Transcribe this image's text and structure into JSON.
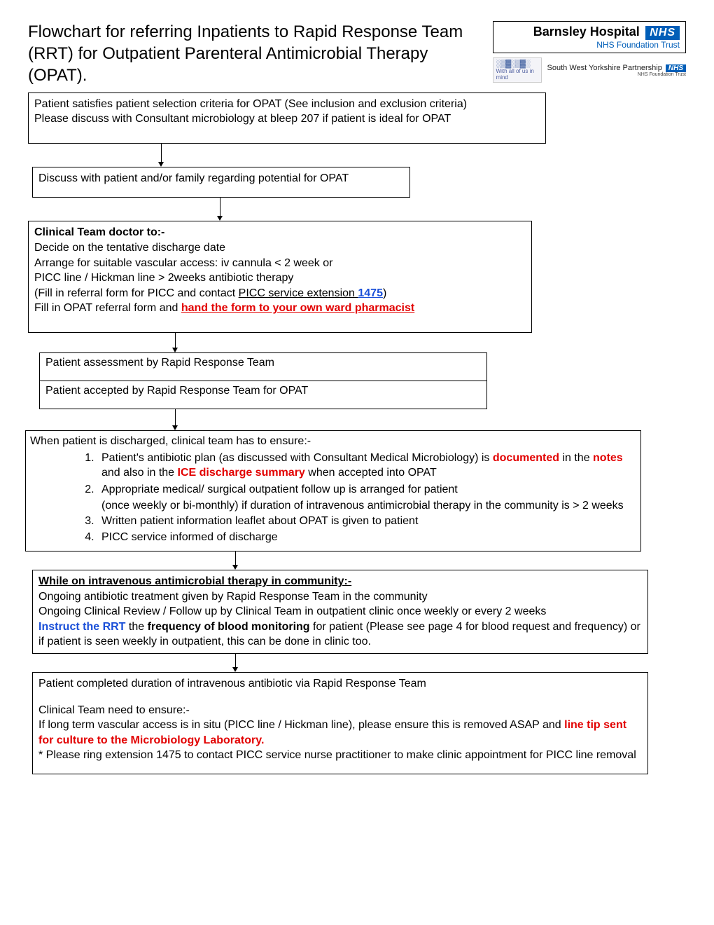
{
  "title": "Flowchart for referring Inpatients to Rapid Response Team (RRT) for Outpatient Parenteral Antimicrobial Therapy (OPAT).",
  "logo1": {
    "hospital": "Barnsley Hospital",
    "nhs": "NHS",
    "trust": "NHS Foundation Trust"
  },
  "logo2": {
    "decor": "░▒▓░▒▓░",
    "tagline": "With all of us in mind",
    "partner": "South West Yorkshire Partnership",
    "nhs": "NHS",
    "sub": "NHS Foundation Trust"
  },
  "b1": {
    "l1": "Patient satisfies patient selection criteria for OPAT (See inclusion and exclusion criteria)",
    "l2": "Please discuss with Consultant microbiology at bleep 207 if patient is ideal for OPAT"
  },
  "b2": "Discuss with patient and/or family regarding potential for OPAT",
  "b3": {
    "h": "Clinical Team doctor to:-",
    "l1": "Decide on the tentative discharge date",
    "l2": "Arrange for suitable vascular access: iv cannula < 2 week or",
    "l3": "PICC line / Hickman line > 2weeks antibiotic therapy",
    "l4a": "(Fill in referral form for PICC and contact ",
    "l4b": "PICC service extension ",
    "l4c": "1475",
    "l4d": ")",
    "l5a": "Fill in OPAT referral form and ",
    "l5b": "hand the form to your own  ward pharmacist"
  },
  "b4a": "Patient assessment by Rapid Response Team",
  "b4b": "Patient accepted by Rapid Response Team for OPAT",
  "b5": {
    "intro": "When patient is discharged, clinical team has to ensure:-",
    "li1a": "Patient's antibiotic plan (as discussed with Consultant Medical Microbiology) is ",
    "li1b": "documented",
    "li1c": " in the ",
    "li1d": "notes",
    "li1e": " and also in the ",
    "li1f": "ICE discharge summary",
    "li1g": " when accepted into OPAT",
    "li2a": "Appropriate medical/ surgical outpatient follow up is arranged for patient",
    "li2b": "(once weekly or bi-monthly) if duration of intravenous antimicrobial therapy in the community is > 2 weeks",
    "li3": "Written patient information leaflet about OPAT is given to patient",
    "li4": "PICC service informed of discharge"
  },
  "b6": {
    "h": "While on intravenous antimicrobial therapy in community:-",
    "l1": "Ongoing antibiotic treatment given by Rapid Response Team in the community",
    "l2": "Ongoing Clinical Review / Follow up by Clinical Team in outpatient clinic once weekly or every 2 weeks",
    "l3a": "Instruct the RRT",
    "l3b": " the ",
    "l3c": "frequency of blood monitoring",
    "l3d": " for patient  (Please see page 4 for blood request and frequency) or if patient is seen weekly in outpatient, this can be done in clinic too."
  },
  "b7": {
    "l1": "Patient completed duration of intravenous antibiotic via Rapid Response Team",
    "l2": "Clinical Team need to ensure:-",
    "l3a": "If long term vascular access is in situ (PICC line / Hickman line), please ensure this is removed ASAP and ",
    "l3b": "line tip sent for culture to the Microbiology Laboratory.",
    "l4": "* Please ring extension 1475 to contact PICC service nurse practitioner to make clinic appointment for PICC line removal"
  }
}
